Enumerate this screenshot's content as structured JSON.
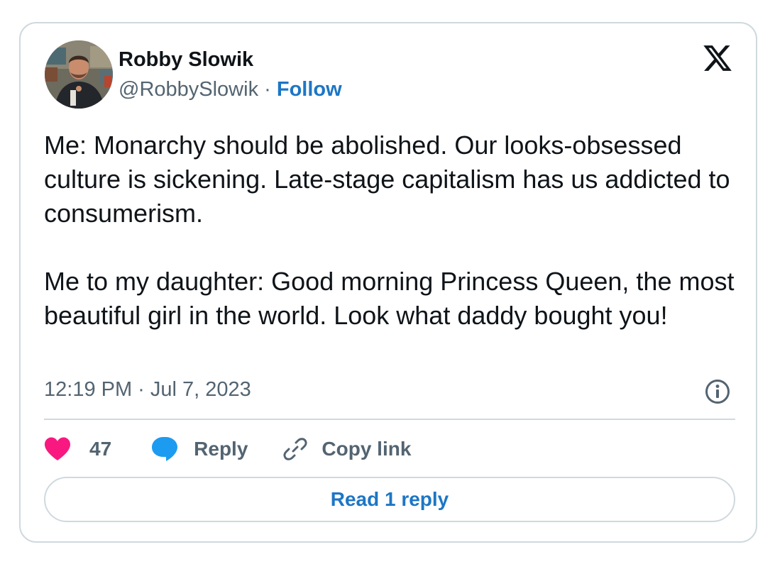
{
  "author": {
    "name": "Robby Slowik",
    "handle": "@RobbySlowik",
    "separator": " · ",
    "follow_label": "Follow",
    "avatar_icon": "user-photo-avatar"
  },
  "brand_icon": "x-logo-icon",
  "tweet": {
    "paragraphs": [
      "Me: Monarchy should be abolished. Our looks-obsessed culture is sickening. Late-stage capitalism has us addicted to consumerism.",
      "Me to my daughter: Good morning Princess Queen, the most beautiful girl in the world. Look what daddy bought you!"
    ],
    "timestamp": "12:19 PM · Jul 7, 2023"
  },
  "actions": {
    "like_count": "47",
    "reply_label": "Reply",
    "copy_link_label": "Copy link"
  },
  "read_replies_label": "Read 1 reply",
  "colors": {
    "text": "#0f1419",
    "secondary_text": "#536471",
    "link_blue": "#1d76c5",
    "like_pink": "#f91880",
    "reply_blue": "#1d9bf0",
    "border": "#cfd9de"
  }
}
